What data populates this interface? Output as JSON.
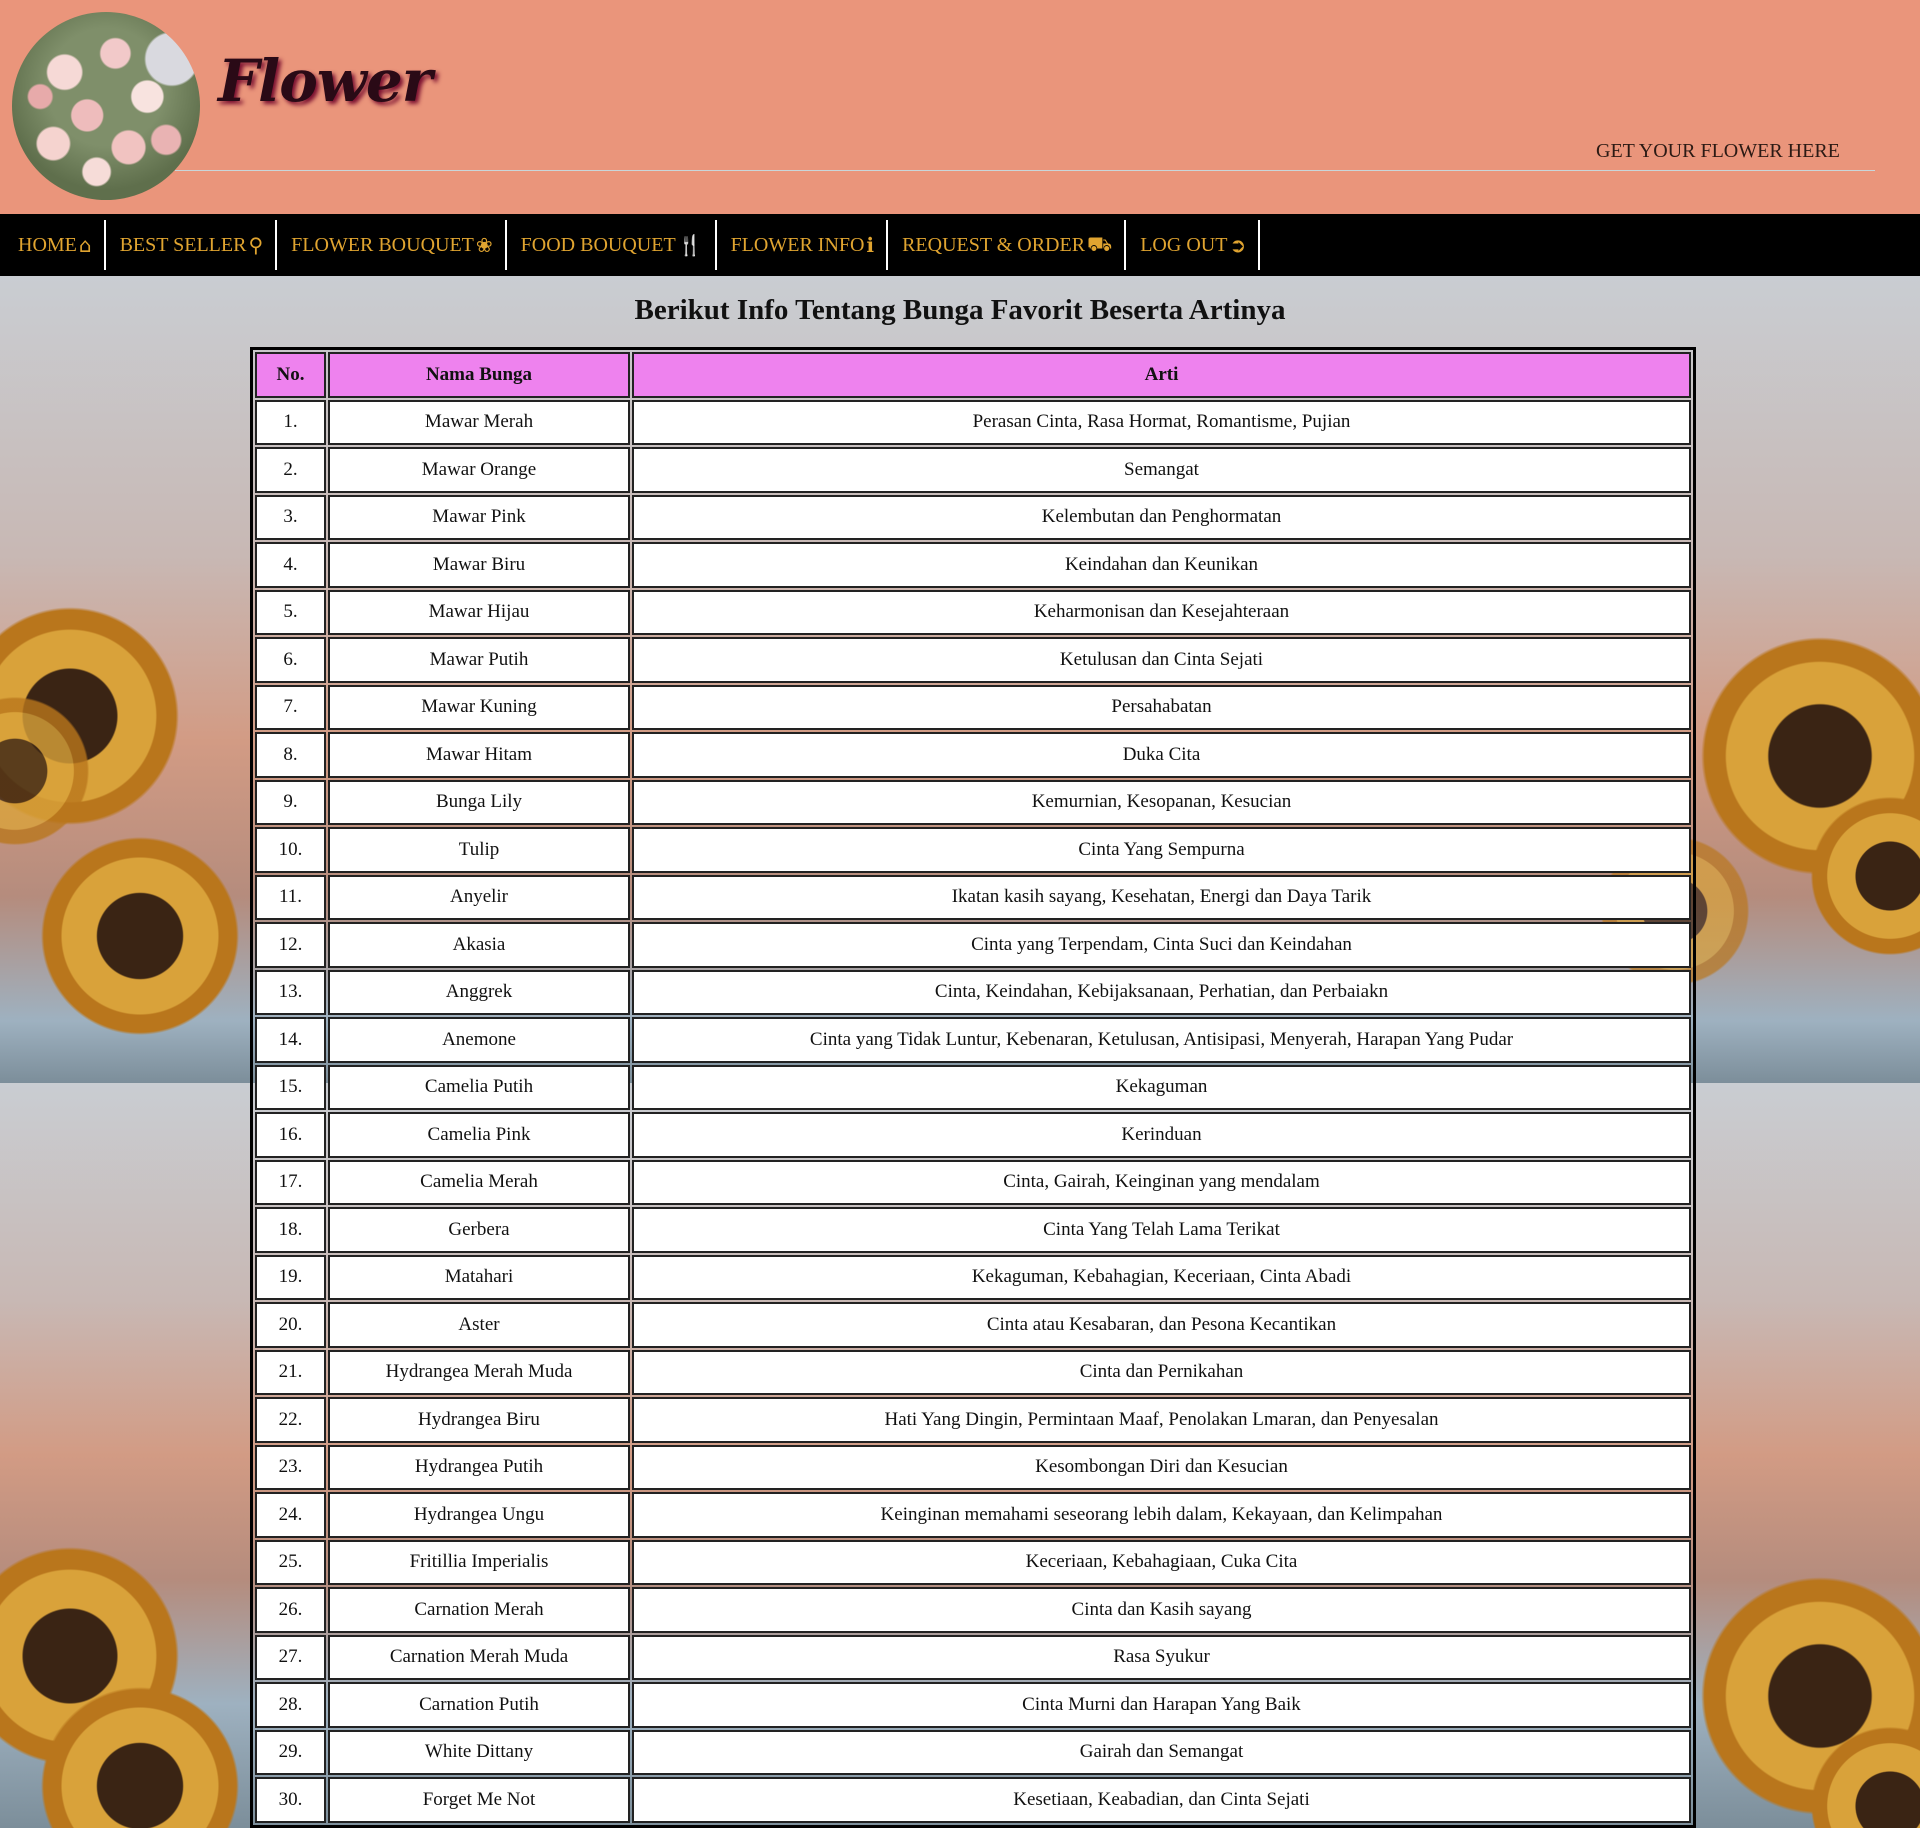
{
  "brand": {
    "title": "Flower",
    "tagline": "GET YOUR FLOWER HERE"
  },
  "nav": [
    {
      "label": "HOME",
      "icon": "home-icon"
    },
    {
      "label": "BEST SELLER",
      "icon": "award-icon"
    },
    {
      "label": "FLOWER BOUQUET",
      "icon": "leaf-icon"
    },
    {
      "label": "FOOD BOUQUET",
      "icon": "cutlery-icon"
    },
    {
      "label": "FLOWER INFO",
      "icon": "info-icon"
    },
    {
      "label": "REQUEST & ORDER",
      "icon": "basket-icon"
    },
    {
      "label": "LOG OUT",
      "icon": "logout-icon"
    }
  ],
  "colors": {
    "header_bg": "#ea957b",
    "nav_bg": "#000000",
    "nav_text": "#e0a430",
    "table_header_bg": "#ee82ee"
  },
  "page": {
    "heading": "Berikut Info Tentang Bunga Favorit Beserta Artinya"
  },
  "table": {
    "headers": [
      "No.",
      "Nama Bunga",
      "Arti"
    ],
    "rows": [
      [
        "1.",
        "Mawar Merah",
        "Perasan Cinta, Rasa Hormat, Romantisme, Pujian"
      ],
      [
        "2.",
        "Mawar Orange",
        "Semangat"
      ],
      [
        "3.",
        "Mawar Pink",
        "Kelembutan dan Penghormatan"
      ],
      [
        "4.",
        "Mawar Biru",
        "Keindahan dan Keunikan"
      ],
      [
        "5.",
        "Mawar Hijau",
        "Keharmonisan dan Kesejahteraan"
      ],
      [
        "6.",
        "Mawar Putih",
        "Ketulusan dan Cinta Sejati"
      ],
      [
        "7.",
        "Mawar Kuning",
        "Persahabatan"
      ],
      [
        "8.",
        "Mawar Hitam",
        "Duka Cita"
      ],
      [
        "9.",
        "Bunga Lily",
        "Kemurnian, Kesopanan, Kesucian"
      ],
      [
        "10.",
        "Tulip",
        "Cinta Yang Sempurna"
      ],
      [
        "11.",
        "Anyelir",
        "Ikatan kasih sayang, Kesehatan, Energi dan Daya Tarik"
      ],
      [
        "12.",
        "Akasia",
        "Cinta yang Terpendam, Cinta Suci dan Keindahan"
      ],
      [
        "13.",
        "Anggrek",
        "Cinta, Keindahan, Kebijaksanaan, Perhatian, dan Perbaiakn"
      ],
      [
        "14.",
        "Anemone",
        "Cinta yang Tidak Luntur, Kebenaran, Ketulusan, Antisipasi, Menyerah, Harapan Yang Pudar"
      ],
      [
        "15.",
        "Camelia Putih",
        "Kekaguman"
      ],
      [
        "16.",
        "Camelia Pink",
        "Kerinduan"
      ],
      [
        "17.",
        "Camelia Merah",
        "Cinta, Gairah, Keinginan yang mendalam"
      ],
      [
        "18.",
        "Gerbera",
        "Cinta Yang Telah Lama Terikat"
      ],
      [
        "19.",
        "Matahari",
        "Kekaguman, Kebahagian, Keceriaan, Cinta Abadi"
      ],
      [
        "20.",
        "Aster",
        "Cinta atau Kesabaran, dan Pesona Kecantikan"
      ],
      [
        "21.",
        "Hydrangea Merah Muda",
        "Cinta dan Pernikahan"
      ],
      [
        "22.",
        "Hydrangea Biru",
        "Hati Yang Dingin, Permintaan Maaf, Penolakan Lmaran, dan Penyesalan"
      ],
      [
        "23.",
        "Hydrangea Putih",
        "Kesombongan Diri dan Kesucian"
      ],
      [
        "24.",
        "Hydrangea Ungu",
        "Keinginan memahami seseorang lebih dalam, Kekayaan, dan Kelimpahan"
      ],
      [
        "25.",
        "Fritillia Imperialis",
        "Keceriaan, Kebahagiaan, Cuka Cita"
      ],
      [
        "26.",
        "Carnation Merah",
        "Cinta dan Kasih sayang"
      ],
      [
        "27.",
        "Carnation Merah Muda",
        "Rasa Syukur"
      ],
      [
        "28.",
        "Carnation Putih",
        "Cinta Murni dan Harapan Yang Baik"
      ],
      [
        "29.",
        "White Dittany",
        "Gairah dan Semangat"
      ],
      [
        "30.",
        "Forget Me Not",
        "Kesetiaan, Keabadian, dan Cinta Sejati"
      ]
    ]
  }
}
